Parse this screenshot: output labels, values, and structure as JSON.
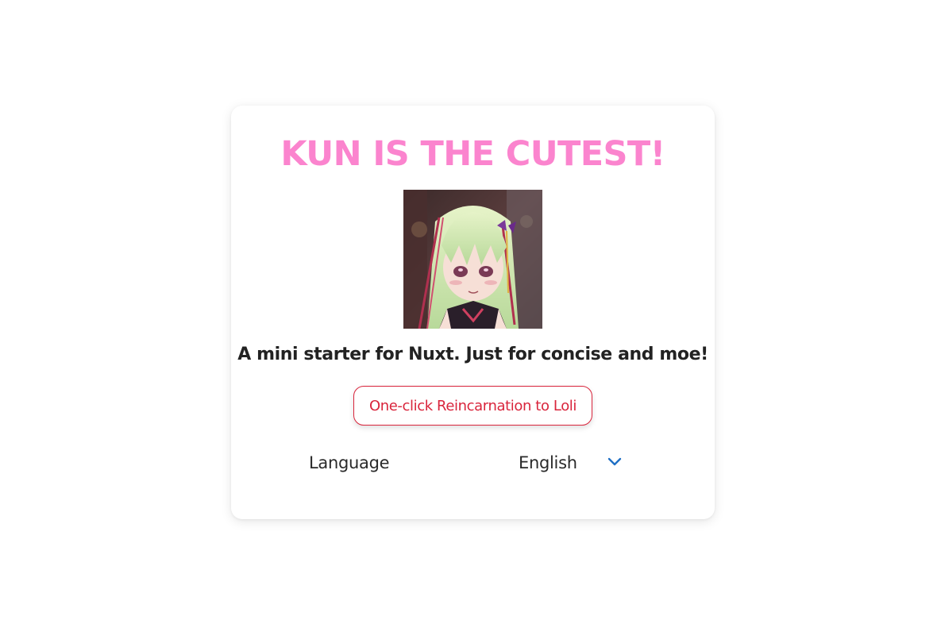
{
  "card": {
    "title": "KUN IS THE CUTEST!",
    "image_alt": "kun",
    "tagline": "A mini starter for Nuxt. Just for concise and moe!",
    "reincarnate_button": "One-click Reincarnation to Loli"
  },
  "language": {
    "label": "Language",
    "selected": "English",
    "icon": "chevron-down-icon"
  },
  "colors": {
    "title": "#fb84ce",
    "button": "#d9253c",
    "chevron": "#1f6fc5"
  }
}
